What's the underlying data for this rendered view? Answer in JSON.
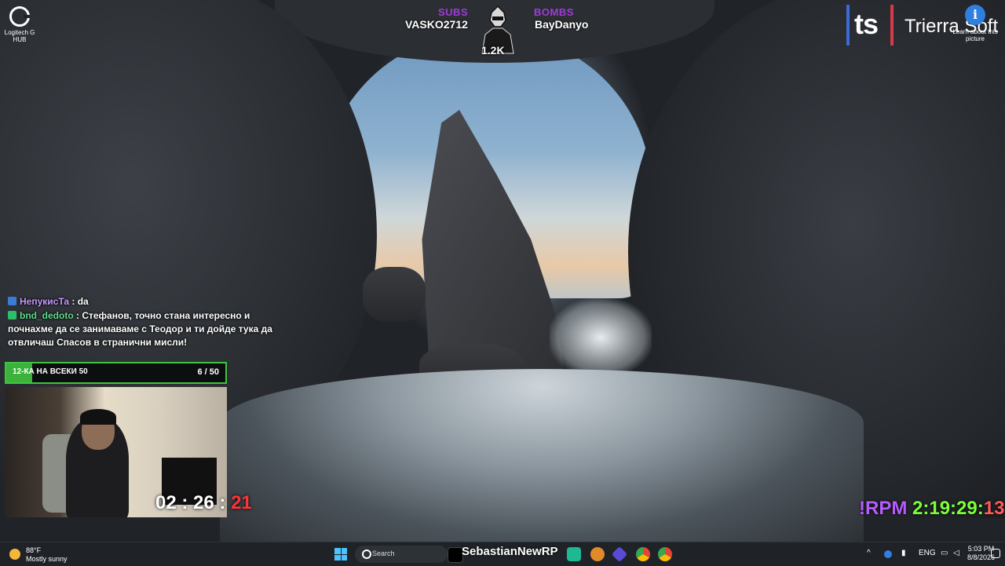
{
  "desktop": {
    "ghub_label": "Logitech G HUB",
    "learn_about": "Learn about this picture"
  },
  "stream_overlay": {
    "subs_label": "SUBS",
    "subs_name": "VASKO2712",
    "bombs_label": "BOMBS",
    "bombs_name": "BayDanyo",
    "mascot_count": "1.2K"
  },
  "brand": {
    "ts_mark": "ts",
    "name": "Trierra Soft"
  },
  "chat": [
    {
      "user": "НепукисТа",
      "sep": " : ",
      "text": "da"
    },
    {
      "user": "bnd_dedoto",
      "sep": " : ",
      "text": "Стефанов, точно стана интересно и почнахме да се занимаваме с Теодор и ти дойде тука да отвличаш Спасов в странични мисли!"
    }
  ],
  "goal": {
    "label": "12-КА НА ВСЕКИ 50",
    "count": "6 / 50",
    "progress": 0.12
  },
  "webcam_timer": {
    "h": "02",
    "m": "26",
    "s": "21"
  },
  "rpm": {
    "label": "!RPM",
    "time": "2:19:29:",
    "seconds": "13"
  },
  "taskbar": {
    "temp": "88°F",
    "condition": "Mostly sunny",
    "search_placeholder": "Search",
    "tiktok_name": "SebastianNewRP",
    "lang": "ENG",
    "time": "5:03 PM",
    "date": "8/8/2026"
  },
  "colors": {
    "subs": "#a03bd8",
    "goal_green": "#3ec43e",
    "rpm_purple": "#b45cff",
    "rpm_green": "#7cff3a",
    "rpm_red": "#ff5a5a"
  }
}
